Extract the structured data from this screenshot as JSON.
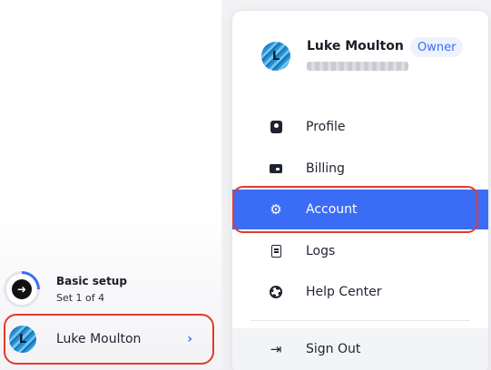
{
  "sidebar": {
    "setup": {
      "title": "Basic setup",
      "subtitle": "Set 1 of 4",
      "progress": 0.25
    },
    "user": {
      "name": "Luke Moulton",
      "avatar_initial": "L",
      "chevron": "›"
    }
  },
  "menu": {
    "user": {
      "name": "Luke Moulton",
      "avatar_initial": "L",
      "badge": "Owner"
    },
    "items": [
      {
        "label": "Profile",
        "icon": "profile-icon"
      },
      {
        "label": "Billing",
        "icon": "billing-icon"
      },
      {
        "label": "Account",
        "icon": "gear-icon",
        "selected": true
      },
      {
        "label": "Logs",
        "icon": "logs-icon"
      },
      {
        "label": "Help Center",
        "icon": "help-icon"
      }
    ],
    "signout": {
      "label": "Sign Out",
      "icon": "sign-out-icon"
    }
  },
  "colors": {
    "accent": "#3b6cf6",
    "highlight_outline": "#e23b2a"
  }
}
